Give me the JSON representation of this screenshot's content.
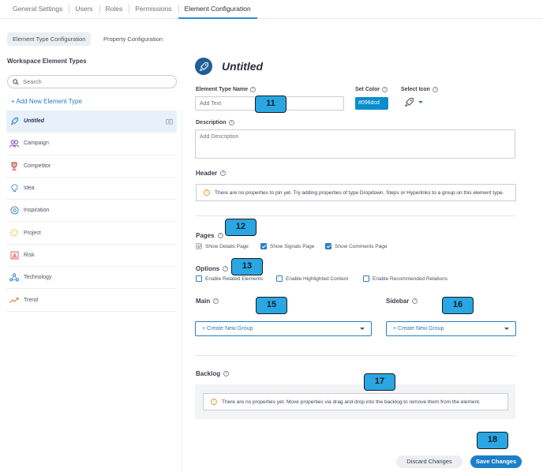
{
  "top_tabs": [
    "General Settings",
    "Users",
    "Roles",
    "Permissions",
    "Element Configuration"
  ],
  "sub_tabs": [
    "Element Type Configuration",
    "Property Configuration"
  ],
  "left": {
    "title": "Workspace Element Types",
    "search_placeholder": "Search",
    "add_label": "+ Add New Element Type",
    "types": [
      {
        "label": "Untitled",
        "icon": "rocket-icon",
        "color": "#1f5e97"
      },
      {
        "label": "Campaign",
        "icon": "people-icon",
        "color": "#7b3fb0"
      },
      {
        "label": "Competitor",
        "icon": "trophy-icon",
        "color": "#c0392b"
      },
      {
        "label": "Idea",
        "icon": "lightbulb-icon",
        "color": "#3a8fd6"
      },
      {
        "label": "Inspiration",
        "icon": "compass-icon",
        "color": "#2b7cc1"
      },
      {
        "label": "Project",
        "icon": "sun-icon",
        "color": "#e2a21b"
      },
      {
        "label": "Risk",
        "icon": "hazard-icon",
        "color": "#d9534f"
      },
      {
        "label": "Technology",
        "icon": "network-icon",
        "color": "#2b7cc1"
      },
      {
        "label": "Trend",
        "icon": "trend-line-icon",
        "color": "#e67e22"
      }
    ]
  },
  "entity": {
    "title": "Untitled"
  },
  "form": {
    "name_label": "Element Type Name",
    "name_placeholder": "Add Text",
    "color_label": "Set Color",
    "color_value": "#098dcd",
    "icon_label": "Select Icon",
    "description_label": "Description",
    "description_placeholder": "Add Description"
  },
  "header_section": {
    "label": "Header",
    "message": "There are no properties to pin yet. Try adding properties of type Dropdown, Steps or Hyperlinks to a group on this element type."
  },
  "pages": {
    "label": "Pages",
    "items": [
      {
        "label": "Show Details Page",
        "checked": true,
        "disabled": true
      },
      {
        "label": "Show Signals Page",
        "checked": true,
        "disabled": false
      },
      {
        "label": "Show Comments Page",
        "checked": true,
        "disabled": false
      }
    ]
  },
  "options": {
    "label": "Options",
    "items": [
      {
        "label": "Enable Related Elements",
        "checked": false
      },
      {
        "label": "Enable Highlighted Content",
        "checked": false
      },
      {
        "label": "Enable Recommended Relations",
        "checked": false
      }
    ]
  },
  "main": {
    "label": "Main",
    "dropdown": "+ Create New Group"
  },
  "sidebar": {
    "label": "Sidebar",
    "dropdown": "+ Create New Group"
  },
  "backlog": {
    "label": "Backlog",
    "message": "There are no properties yet. Move properties via drag and drop into the backlog to remove them from the element."
  },
  "buttons": {
    "discard": "Discard Changes",
    "save": "Save Changes"
  },
  "callouts": [
    "11",
    "12",
    "13",
    "15",
    "16",
    "17",
    "18"
  ],
  "colors": {
    "accent": "#2b7cc1",
    "callout": "#2aa6e3",
    "save": "#1d7fc8"
  }
}
